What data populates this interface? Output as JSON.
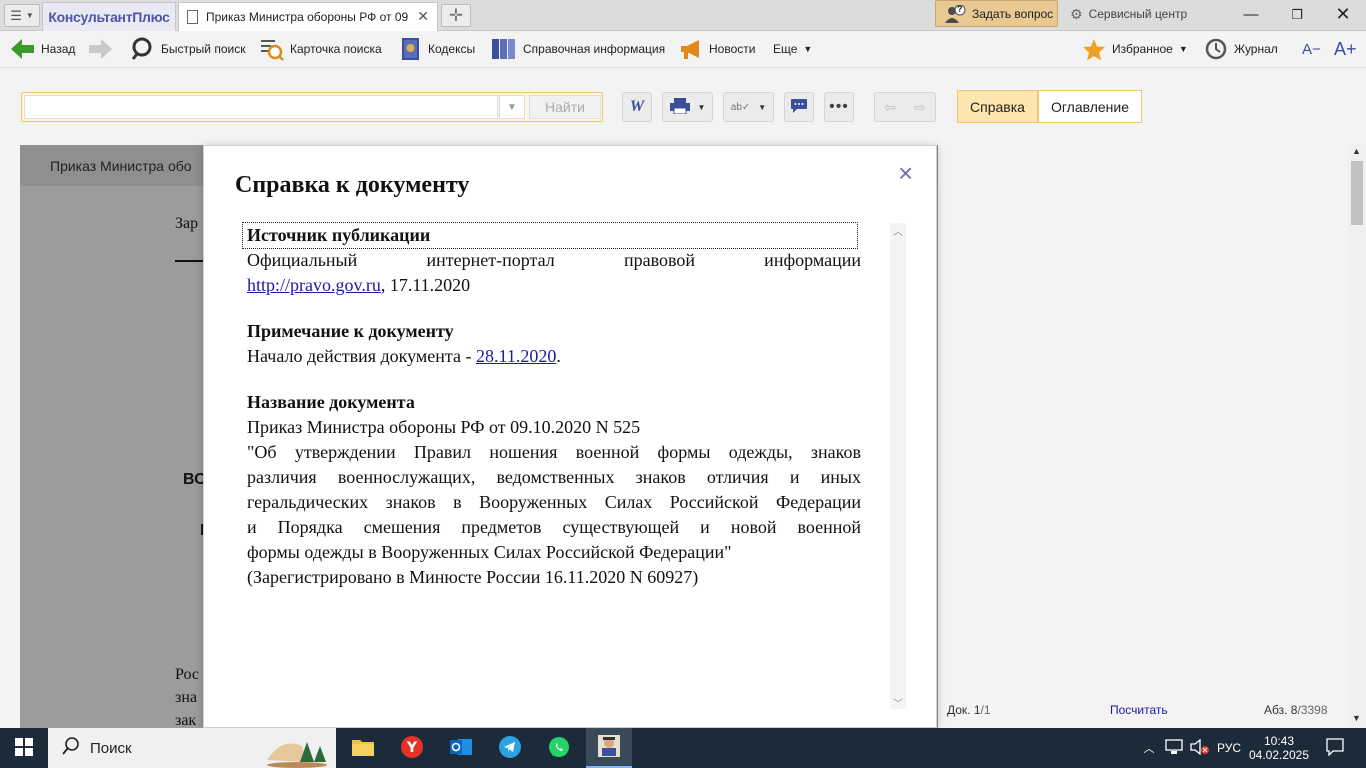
{
  "titlebar": {
    "logo": "КонсультантПлюс",
    "tab_title": "Приказ Министра обороны РФ от 09",
    "ask_question": "Задать вопрос",
    "ask_badge": "?",
    "service_center": "Сервисный центр"
  },
  "toolbar": {
    "back": "Назад",
    "quick_search": "Быстрый поиск",
    "search_card": "Карточка поиска",
    "codes": "Кодексы",
    "reference_info": "Справочная информация",
    "news": "Новости",
    "more": "Еще",
    "favorites": "Избранное",
    "journal": "Журнал",
    "font_decrease": "A−",
    "font_increase": "A+"
  },
  "search": {
    "placeholder": "",
    "find_button": "Найти"
  },
  "panel_tabs": {
    "reference": "Справка",
    "contents": "Оглавление"
  },
  "document": {
    "header": "Приказ Министра обо",
    "frag1": "Зар",
    "frag2": "ВО",
    "frag3": "I",
    "frag4": "Рос",
    "frag5": "зна",
    "frag6": "зак"
  },
  "status": {
    "doc_label": "Док. 1",
    "doc_total": "/1",
    "count_link": "Посчитать",
    "para_label": "Абз. 8",
    "para_total": "/3398"
  },
  "modal": {
    "title": "Справка к документу",
    "close": "×",
    "source_head": "Источник публикации",
    "source_line1": "Официальный интернет-портал правовой информации",
    "source_link": "http://pravo.gov.ru",
    "source_rest": ", 17.11.2020",
    "note_head": "Примечание к документу",
    "note_text": "Начало действия документа - ",
    "note_link": "28.11.2020",
    "note_end": ".",
    "name_head": "Название документа",
    "name_line1": "Приказ Министра обороны РФ от 09.10.2020 N 525",
    "name_line2": "\"Об утверждении Правил ношения военной формы одежды, знаков",
    "name_line3": "различия военнослужащих, ведомственных знаков отличия и иных",
    "name_line4": "геральдических знаков в Вооруженных Силах Российской Федерации",
    "name_line5": "и Порядка смешения предметов существующей и новой военной",
    "name_line6": "формы одежды в Вооруженных Силах Российской Федерации\"",
    "name_line7": "(Зарегистрировано в Минюсте России 16.11.2020 N 60927)"
  },
  "taskbar": {
    "search": "Поиск",
    "lang": "РУС",
    "time": "10:43",
    "date": "04.02.2025"
  },
  "colors": {
    "accent": "#f0c66e",
    "link": "#1a1aa6",
    "taskbar": "#1c2b39"
  }
}
